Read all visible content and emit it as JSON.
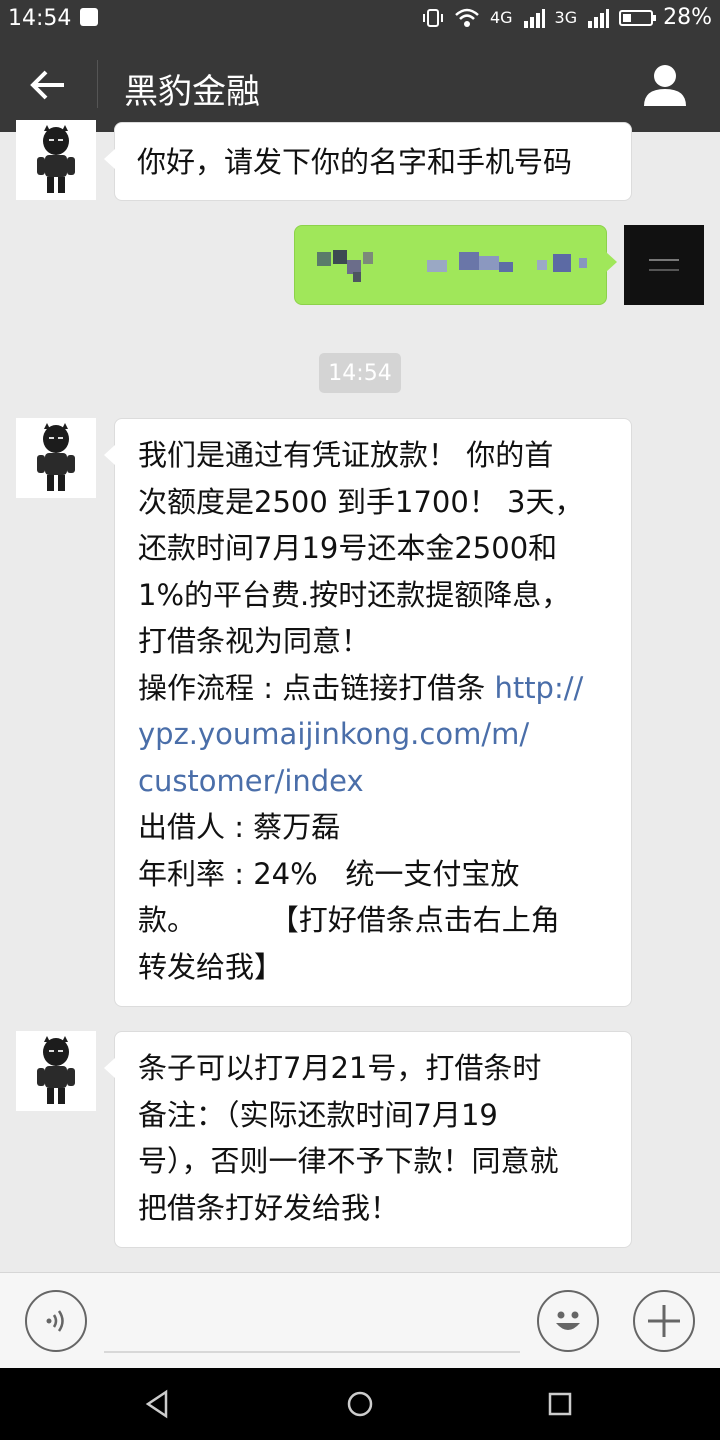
{
  "status_bar": {
    "time": "14:54",
    "net1": "4G",
    "net2": "3G",
    "battery": "28%"
  },
  "header": {
    "title": "黑豹金融"
  },
  "messages": {
    "m1": "你好，请发下你的名字和手机号码",
    "timestamp": "14:54",
    "m3_lines": [
      "我们是通过有凭证放款！ 你的首",
      "次额度是2500 到手1700！ 3天，",
      "还款时间7月19号还本金2500和",
      "1%的平台费.按时还款提额降息，",
      "打借条视为同意！"
    ],
    "m3_flow_label": "操作流程 : 点击链接打借条 ",
    "m3_link_lines": [
      "http://",
      "ypz.youmaijinkong.com/m/",
      "customer/index"
    ],
    "m3_tail_lines": [
      "出借人 : 蔡万磊",
      "年利率 : 24%   统一支付宝放",
      "款。        【打好借条点击右上角",
      "转发给我】"
    ],
    "m4_lines": [
      "条子可以打7月21号，打借条时",
      "备注：（实际还款时间7月19",
      "号），否则一律不予下款！同意就",
      "把借条打好发给我！"
    ]
  },
  "colors": {
    "header_bg": "#383838",
    "chat_bg": "#ebebeb",
    "sent_bubble": "#a0e75a",
    "link": "#4a6ea9"
  },
  "icons": {
    "back": "arrow-left-icon",
    "profile": "user-icon",
    "voice": "voice-icon",
    "emoji": "smiley-icon",
    "more": "plus-icon"
  }
}
